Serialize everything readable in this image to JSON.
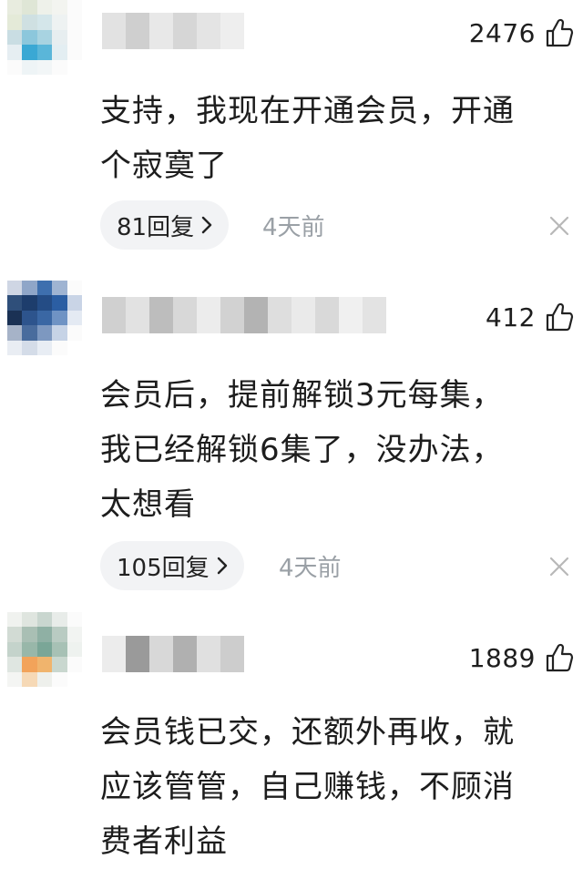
{
  "comments": [
    {
      "likes": "2476",
      "lines": [
        "支持，我现在开通会员，开通",
        "个寂寞了"
      ],
      "reply_label": "81回复",
      "time": "4天前"
    },
    {
      "likes": "412",
      "lines": [
        "会员后，提前解锁3元每集，",
        "我已经解锁6集了，没办法，",
        "太想看"
      ],
      "reply_label": "105回复",
      "time": "4天前"
    },
    {
      "likes": "1889",
      "lines": [
        "会员钱已交，还额外再收，就",
        "应该管管，自己赚钱，不顾消",
        "费者利益"
      ]
    }
  ],
  "icons": {
    "like": "thumbs-up-icon",
    "chevron": "chevron-right-icon",
    "dismiss": "close-icon"
  },
  "colors": {
    "reply_chip_bg": "#f2f3f5",
    "time_text": "#9aa0a6",
    "body_text": "#1d1d1d"
  }
}
